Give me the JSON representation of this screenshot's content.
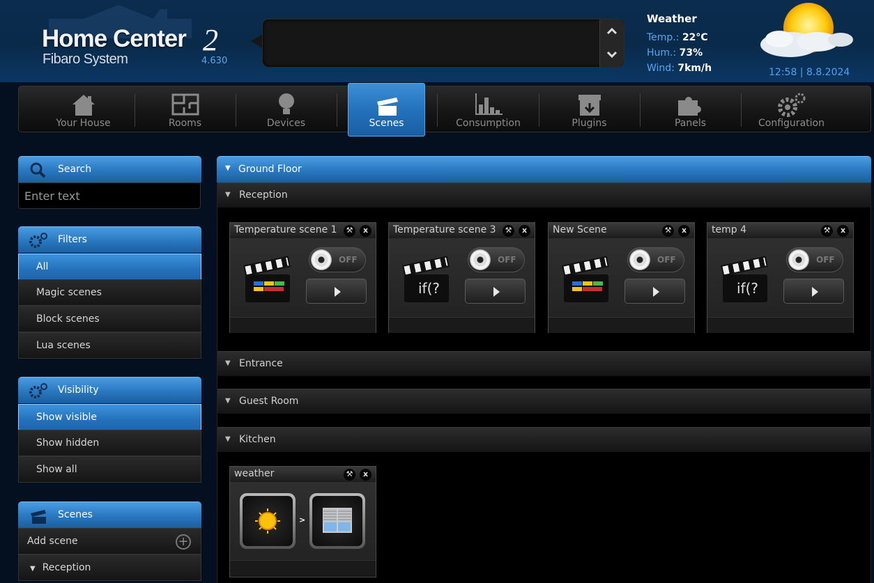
{
  "header": {
    "logo_title": "Home Center",
    "logo_number": "2",
    "logo_subtitle": "Fibaro System",
    "version": "4.630"
  },
  "weather": {
    "title": "Weather",
    "temp_label": "Temp.:",
    "temp_value": "22°C",
    "hum_label": "Hum.:",
    "hum_value": "73%",
    "wind_label": "Wind:",
    "wind_value": "7km/h",
    "datetime": "12:58 | 8.8.2024"
  },
  "nav": {
    "items": [
      {
        "label": "Your House",
        "icon": "house-icon"
      },
      {
        "label": "Rooms",
        "icon": "floorplan-icon"
      },
      {
        "label": "Devices",
        "icon": "bulb-icon"
      },
      {
        "label": "Scenes",
        "icon": "clapper-icon",
        "active": true
      },
      {
        "label": "Consumption",
        "icon": "chart-icon"
      },
      {
        "label": "Plugins",
        "icon": "box-icon"
      },
      {
        "label": "Panels",
        "icon": "puzzle-icon"
      },
      {
        "label": "Configuration",
        "icon": "gears-icon"
      }
    ]
  },
  "sidebar": {
    "search": {
      "title": "Search",
      "placeholder": "Enter text",
      "value": ""
    },
    "filters": {
      "title": "Filters",
      "items": [
        "All",
        "Magic scenes",
        "Block scenes",
        "Lua scenes"
      ],
      "active": "All"
    },
    "visibility": {
      "title": "Visibility",
      "items": [
        "Show visible",
        "Show hidden",
        "Show all"
      ],
      "active": "Show visible"
    },
    "scenes": {
      "title": "Scenes",
      "add_label": "Add scene",
      "rooms": [
        "Reception"
      ]
    }
  },
  "main": {
    "floor": "Ground Floor",
    "rooms": [
      {
        "name": "Reception",
        "scenes": [
          {
            "name": "Temperature scene 1",
            "type": "magic",
            "state": "OFF"
          },
          {
            "name": "Temperature scene 3",
            "type": "lua",
            "state": "OFF"
          },
          {
            "name": "New Scene",
            "type": "magic",
            "state": "OFF"
          },
          {
            "name": "temp 4",
            "type": "lua",
            "state": "OFF"
          }
        ]
      },
      {
        "name": "Entrance",
        "scenes": []
      },
      {
        "name": "Guest Room",
        "scenes": []
      },
      {
        "name": "Kitchen",
        "scenes": [
          {
            "name": "weather",
            "type": "block",
            "separator": ">"
          }
        ]
      }
    ],
    "lua_symbol": "if(?"
  },
  "colors": {
    "accent_blue": "#2b7ac3",
    "header_bg": "#0a2a4a",
    "weather_label": "#58a6ef"
  }
}
